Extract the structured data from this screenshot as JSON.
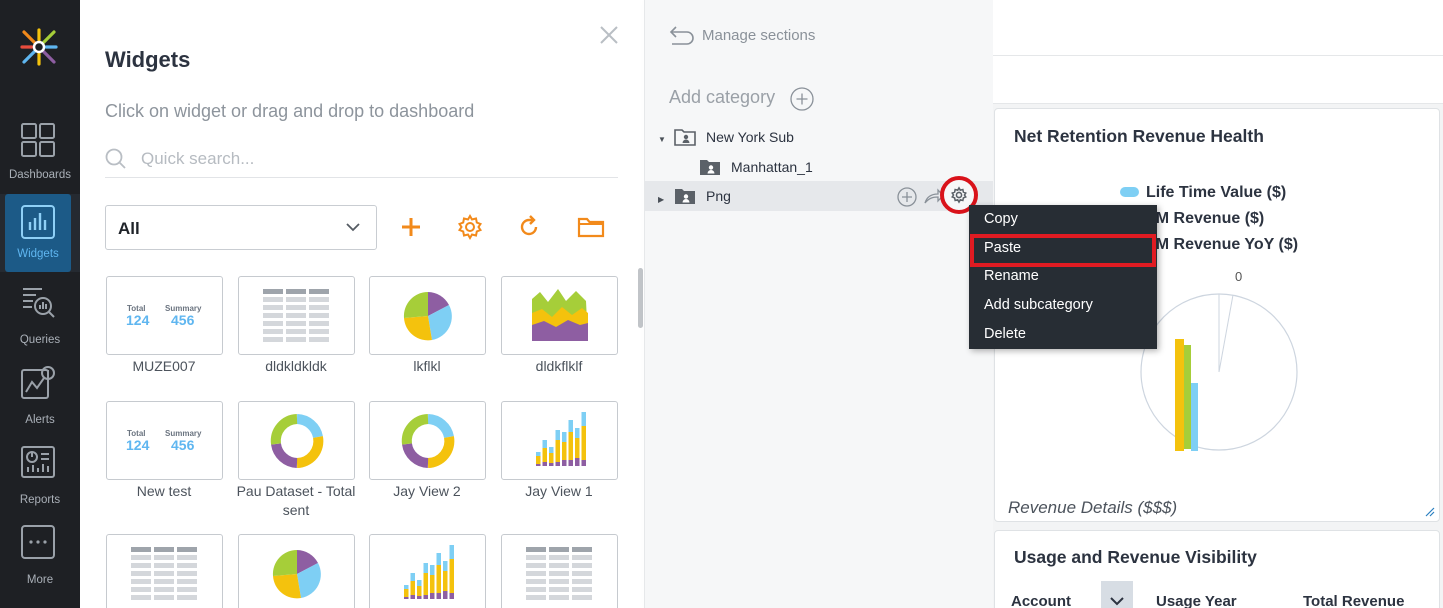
{
  "nav": {
    "items": [
      {
        "label": "Dashboards",
        "icon": "dashboards-icon"
      },
      {
        "label": "Widgets",
        "icon": "widgets-icon",
        "active": true
      },
      {
        "label": "Queries",
        "icon": "queries-icon"
      },
      {
        "label": "Alerts",
        "icon": "alerts-icon"
      },
      {
        "label": "Reports",
        "icon": "reports-icon"
      },
      {
        "label": "More",
        "icon": "more-icon"
      }
    ]
  },
  "widgets_panel": {
    "title": "Widgets",
    "subtitle": "Click on widget or drag and drop to dashboard",
    "search_placeholder": "Quick search...",
    "filter_value": "All",
    "tiles": [
      {
        "caption": "MUZE007",
        "kind": "kpi"
      },
      {
        "caption": "dldkldkldk",
        "kind": "table"
      },
      {
        "caption": "lkflkl",
        "kind": "pie"
      },
      {
        "caption": "dldkflklf",
        "kind": "area"
      },
      {
        "caption": "New test",
        "kind": "kpi"
      },
      {
        "caption": "Pau Dataset - Total sent",
        "kind": "donut"
      },
      {
        "caption": "Jay View 2",
        "kind": "donut"
      },
      {
        "caption": "Jay View 1",
        "kind": "bars"
      },
      {
        "caption": "",
        "kind": "table"
      },
      {
        "caption": "",
        "kind": "pie"
      },
      {
        "caption": "",
        "kind": "bars"
      },
      {
        "caption": "",
        "kind": "table"
      }
    ],
    "kpi": {
      "label1": "Total",
      "value1": "124",
      "label2": "Summary",
      "value2": "456"
    }
  },
  "sections_panel": {
    "manage_label": "Manage sections",
    "add_category_label": "Add category",
    "tree": [
      {
        "label": "New York Sub",
        "expanded": true
      },
      {
        "label": "Manhattan_1"
      },
      {
        "label": "Png",
        "expanded": false
      }
    ]
  },
  "context_menu": {
    "items": [
      "Copy",
      "Paste",
      "Rename",
      "Add subcategory",
      "Delete"
    ],
    "selected": "Paste"
  },
  "dashboard": {
    "card1": {
      "title": "Net Retention Revenue Health",
      "legend": [
        "Life Time Value ($)",
        "TM Revenue ($)",
        "TM Revenue YoY ($)"
      ],
      "legend_colors": [
        "#7ecff4",
        "#f4c20d",
        "#a6ce39"
      ],
      "zero_label": "0",
      "footer": "Revenue Details ($$$)"
    },
    "card2": {
      "title": "Usage and Revenue Visibility",
      "columns": [
        "Account",
        "Usage Year",
        "Total Revenue"
      ]
    }
  },
  "colors": {
    "accent_orange": "#f28a1b",
    "nav_bg": "#1e2024",
    "menu_bg": "#272d34",
    "highlight_red": "#e01b22"
  }
}
